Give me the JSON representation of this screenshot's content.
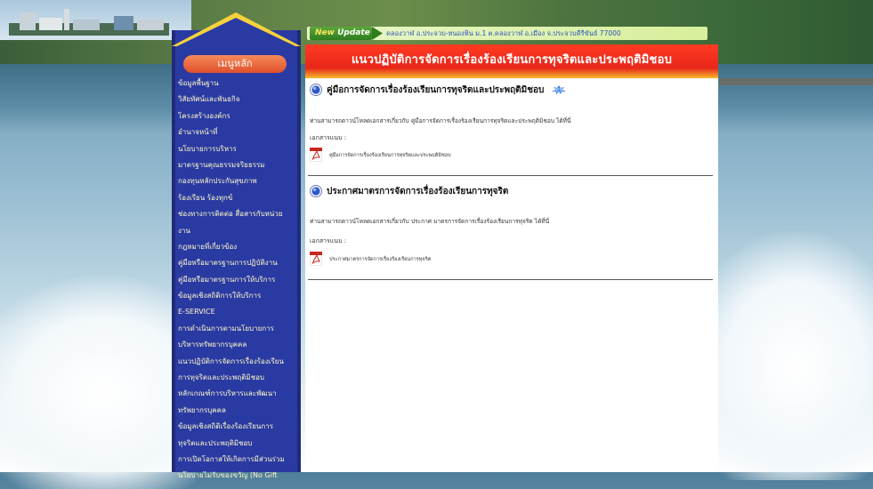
{
  "sidebar": {
    "header": "เมนูหลัก",
    "items": [
      "ข้อมูลพื้นฐาน",
      "วิสัยทัศน์และพันธกิจ",
      "โครงสร้างองค์กร",
      "อำนาจหน้าที่",
      "นโยบายการบริหาร",
      "มาตรฐานคุณธรรมจริยธรรม",
      "กองทุนหลักประกันสุขภาพ",
      "ร้องเรียน ร้องทุกข์",
      "ช่องทางการติดต่อ สื่อสารกับหน่วย",
      "งาน",
      "กฎหมายที่เกี่ยวข้อง",
      "คู่มือหรือมาตรฐานการปฏิบัติงาน",
      "คู่มือหรือมาตรฐานการให้บริการ",
      "ข้อมูลเชิงสถิติการให้บริการ",
      "E-SERVICE",
      "การดำเนินการตามนโยบายการ",
      "บริหารทรัพยากรบุคคล",
      "แนวปฏิบัติการจัดการเรื่องร้องเรียน",
      "การทุจริตและประพฤติมิชอบ",
      "หลักเกณฑ์การบริหารและพัฒนา",
      "ทรัพยากรบุคคล",
      "ข้อมูลเชิงสถิติเรื่องร้องเรียนการ",
      "ทุจริตและประพฤติมิชอบ",
      "การเปิดโอกาสให้เกิดการมีส่วนร่วม",
      "นโยบายไม่รับของขวัญ (No Gift"
    ]
  },
  "news": {
    "badge_new": "New",
    "badge_update": "Update",
    "text": "คลองวาฬ อ.ประจวบ-หนองหิน ม.1 ต.คลองวาฬ อ.เมือง จ.ประจวบคีรีขันธ์ 77000"
  },
  "page": {
    "title": "แนวปฏิบัติการจัดการเรื่องร้องเรียนการทุจริตและประพฤติมิชอบ"
  },
  "sections": [
    {
      "title": "คู่มือการจัดการเรื่องร้องเรียนการทุจริตและประพฤติมิชอบ",
      "description": "ท่านสามารถดาวน์โหลดเอกสารเกี่ยวกับ คู่มือการจัดการเรื่องร้องเรียนการทุจริตและประพฤติมิชอบ ได้ที่นี่",
      "attachment_label": "เอกสารแนบ :",
      "file": "คู่มือการจัดการเรื่องร้องเรียนการทุจริตและประพฤติมิชอบ",
      "has_new_badge": true
    },
    {
      "title": "ประกาศมาตรการจัดการเรื่องร้องเรียนการทุจริต",
      "description": "ท่านสามารถดาวน์โหลดเอกสารเกี่ยวกับ ประกาศ มาตรการจัดการเรื่องร้องเรียนการทุจริต ได้ที่นี่",
      "attachment_label": "เอกสารแนบ :",
      "file": "ประกาศมาตรการจัดการเรื่องร้องเรียนการทุจริต",
      "has_new_badge": false
    }
  ],
  "icons": {
    "section_bullet": "blue-orb-icon",
    "new_badge": "new-star-icon",
    "file": "pdf-icon"
  },
  "colors": {
    "sidebar_bg": "#2a3aa3",
    "menu_text": "#fff9c8",
    "title_bar": "#e8261a",
    "news_text": "#2a55b8"
  }
}
